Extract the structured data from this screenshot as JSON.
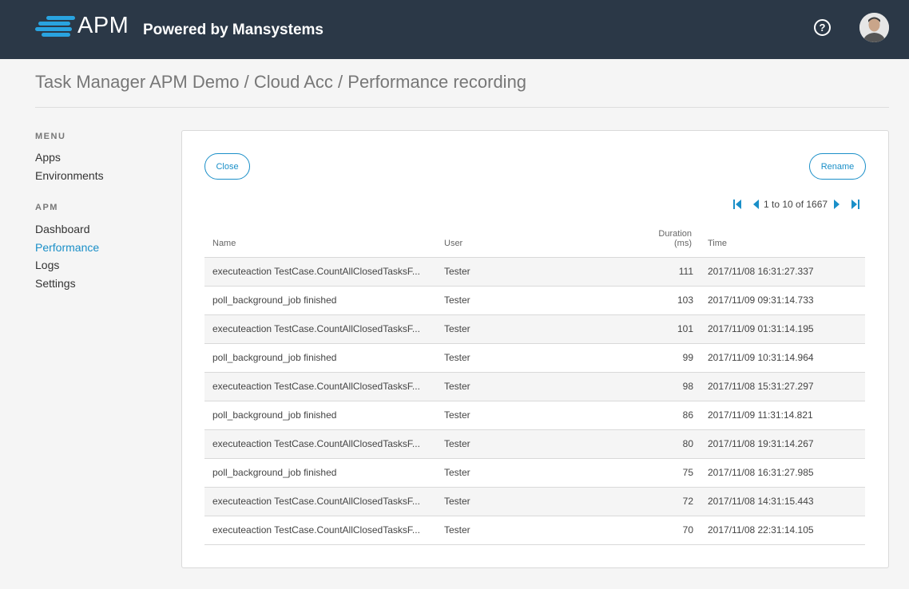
{
  "header": {
    "logo_icon": "apm-stripes-logo",
    "brand": "APM",
    "tagline": "Powered by Mansystems",
    "help_icon": "help-circle-icon",
    "avatar_icon": "user-avatar",
    "bg_color": "#2b3847",
    "logo_color": "#29a3e0"
  },
  "breadcrumb": "Task Manager APM Demo / Cloud Acc / Performance recording",
  "sidebar": {
    "menu_heading": "MENU",
    "menu_items": [
      {
        "label": "Apps"
      },
      {
        "label": "Environments"
      }
    ],
    "apm_heading": "APM",
    "apm_items": [
      {
        "label": "Dashboard"
      },
      {
        "label": "Performance",
        "active": true
      },
      {
        "label": "Logs"
      },
      {
        "label": "Settings"
      }
    ]
  },
  "panel": {
    "close_label": "Close",
    "rename_label": "Rename",
    "pager": {
      "text": "1 to 10 of 1667",
      "first_icon": "first-page-icon",
      "prev_icon": "previous-page-icon",
      "next_icon": "next-page-icon",
      "last_icon": "last-page-icon"
    },
    "columns": {
      "name": "Name",
      "user": "User",
      "duration_line1": "Duration",
      "duration_line2": "(ms)",
      "time": "Time"
    },
    "rows": [
      {
        "name": "executeaction TestCase.CountAllClosedTasksF...",
        "user": "Tester",
        "duration": "111",
        "time": "2017/11/08 16:31:27.337"
      },
      {
        "name": "poll_background_job finished",
        "user": "Tester",
        "duration": "103",
        "time": "2017/11/09 09:31:14.733"
      },
      {
        "name": "executeaction TestCase.CountAllClosedTasksF...",
        "user": "Tester",
        "duration": "101",
        "time": "2017/11/09 01:31:14.195"
      },
      {
        "name": "poll_background_job finished",
        "user": "Tester",
        "duration": "99",
        "time": "2017/11/09 10:31:14.964"
      },
      {
        "name": "executeaction TestCase.CountAllClosedTasksF...",
        "user": "Tester",
        "duration": "98",
        "time": "2017/11/08 15:31:27.297"
      },
      {
        "name": "poll_background_job finished",
        "user": "Tester",
        "duration": "86",
        "time": "2017/11/09 11:31:14.821"
      },
      {
        "name": "executeaction TestCase.CountAllClosedTasksF...",
        "user": "Tester",
        "duration": "80",
        "time": "2017/11/08 19:31:14.267"
      },
      {
        "name": "poll_background_job finished",
        "user": "Tester",
        "duration": "75",
        "time": "2017/11/08 16:31:27.985"
      },
      {
        "name": "executeaction TestCase.CountAllClosedTasksF...",
        "user": "Tester",
        "duration": "72",
        "time": "2017/11/08 14:31:15.443"
      },
      {
        "name": "executeaction TestCase.CountAllClosedTasksF...",
        "user": "Tester",
        "duration": "70",
        "time": "2017/11/08 22:31:14.105"
      }
    ]
  }
}
